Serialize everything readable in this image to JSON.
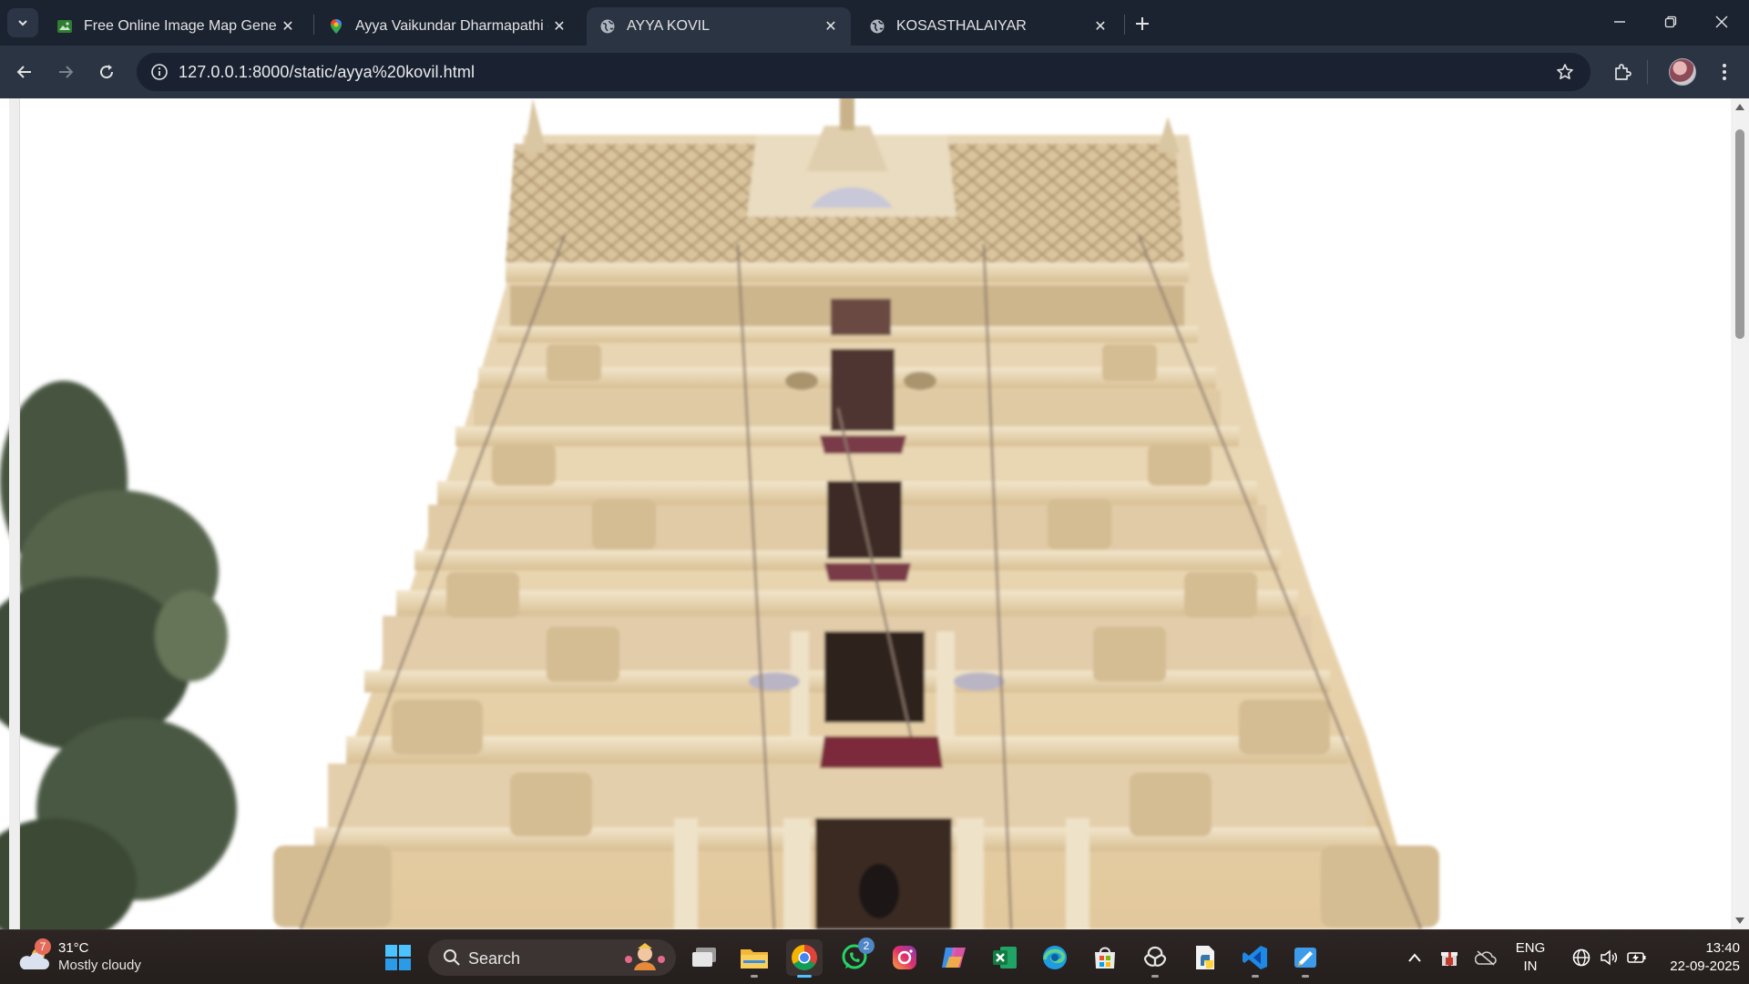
{
  "browser": {
    "tabs": [
      {
        "title": "Free Online Image Map Genera",
        "favicon": "image-map-icon",
        "active": false
      },
      {
        "title": "Ayya Vaikundar Dharmapathi - G",
        "favicon": "maps-pin-icon",
        "active": false
      },
      {
        "title": "AYYA KOVIL",
        "favicon": "globe-icon",
        "active": true
      },
      {
        "title": "KOSASTHALAIYAR",
        "favicon": "globe-icon",
        "active": false
      }
    ],
    "url": "127.0.0.1:8000/static/ayya%20kovil.html"
  },
  "page": {
    "image_subject": "temple-gopuram-photo"
  },
  "taskbar": {
    "weather": {
      "temp": "31°C",
      "condition": "Mostly cloudy",
      "badge": "7"
    },
    "search_label": "Search",
    "whatsapp_badge": "2",
    "language": {
      "line1": "ENG",
      "line2": "IN"
    },
    "clock": {
      "time": "13:40",
      "date": "22-09-2025"
    }
  },
  "colors": {
    "accent": "#4cc2ff",
    "tabstrip": "#1b2331",
    "toolbar": "#2b3443"
  }
}
